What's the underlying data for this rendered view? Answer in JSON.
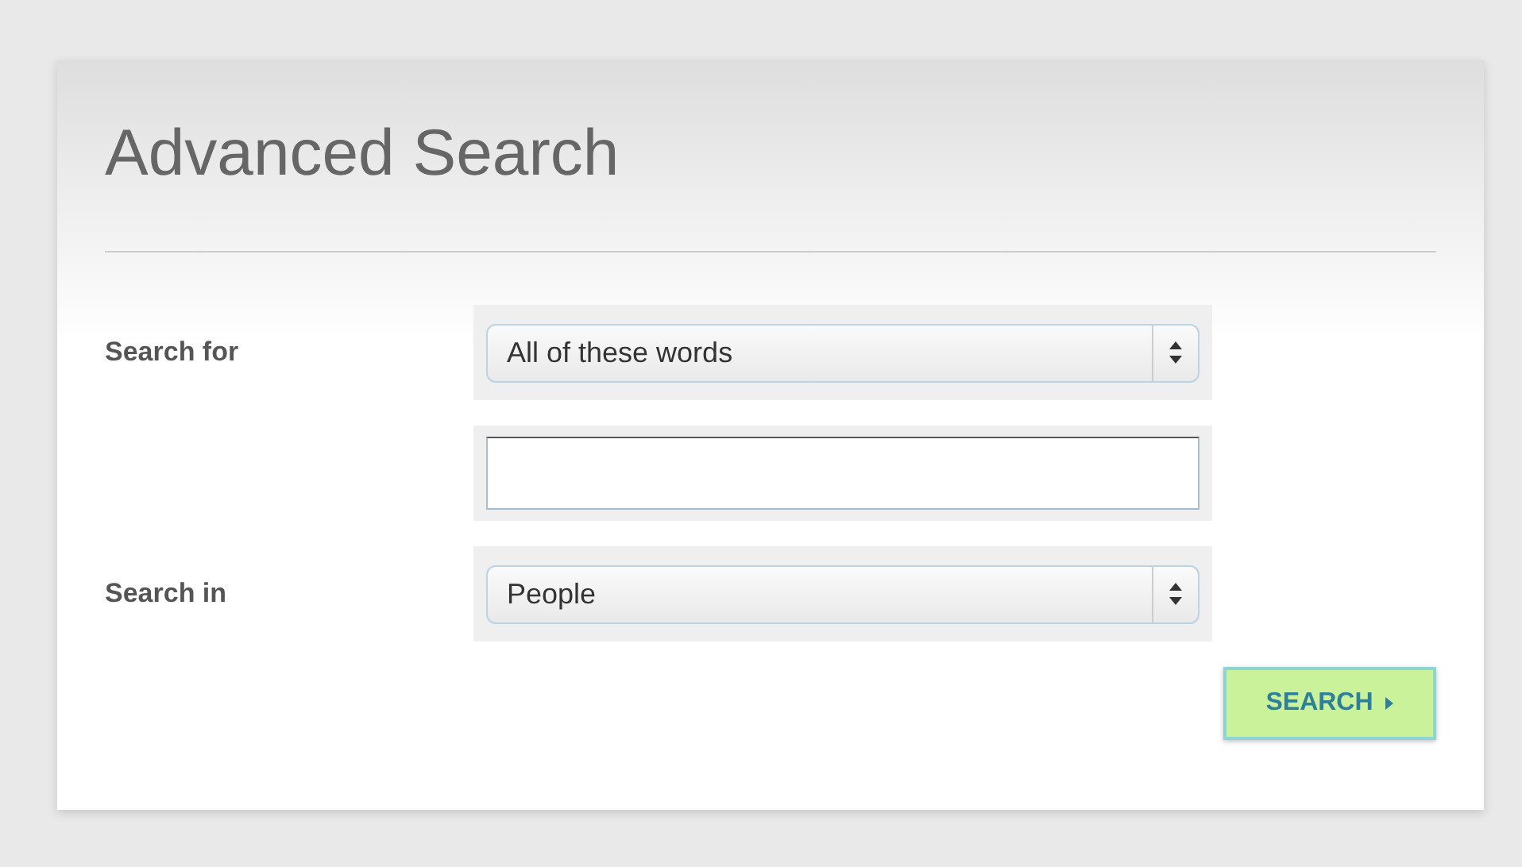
{
  "title": "Advanced Search",
  "fields": [
    {
      "kind": "select",
      "label": "Search for",
      "value": "All of these words"
    },
    {
      "kind": "text"
    },
    {
      "kind": "select",
      "label": "Search in",
      "value": "People"
    }
  ],
  "button": {
    "label": "SEARCH"
  }
}
